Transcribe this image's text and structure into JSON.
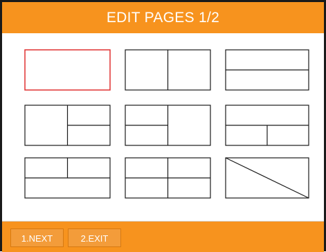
{
  "header": {
    "title": "EDIT PAGES 1/2"
  },
  "layouts": [
    {
      "name": "single",
      "selected": true
    },
    {
      "name": "two-vertical",
      "selected": false
    },
    {
      "name": "two-horizontal",
      "selected": false
    },
    {
      "name": "left-one-right-two",
      "selected": false
    },
    {
      "name": "left-two-right-one",
      "selected": false
    },
    {
      "name": "top-one-bottom-two",
      "selected": false
    },
    {
      "name": "top-two-bottom-one",
      "selected": false
    },
    {
      "name": "four-grid",
      "selected": false
    },
    {
      "name": "diagonal-split",
      "selected": false
    }
  ],
  "footer": {
    "next_label": "1.NEXT",
    "exit_label": "2.EXIT"
  },
  "colors": {
    "accent": "#f7931e",
    "selected_outline": "#e03030",
    "outline": "#1a1a1a"
  }
}
